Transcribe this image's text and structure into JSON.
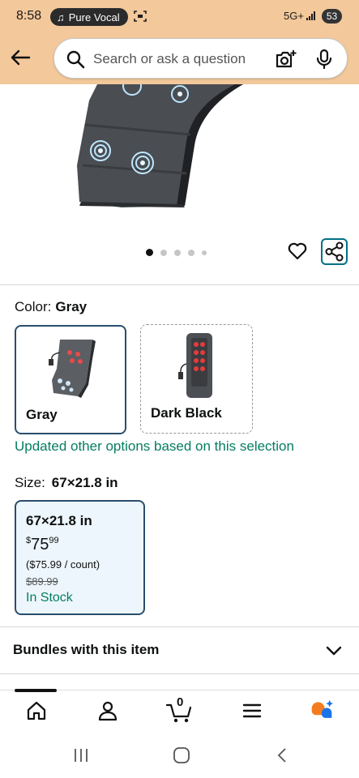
{
  "status_bar": {
    "time": "8:58",
    "pill_label": "Pure Vocal",
    "network": "5G+",
    "battery": "53"
  },
  "search": {
    "placeholder": "Search or ask a question"
  },
  "icons": {
    "back": "back-arrow-icon",
    "search": "search-icon",
    "camera": "camera-search-icon",
    "mic": "microphone-icon",
    "heart": "heart-icon",
    "share": "share-icon"
  },
  "carousel": {
    "count": 5,
    "active_index": 0
  },
  "color": {
    "label": "Color:",
    "selected": "Gray",
    "options": [
      {
        "name": "Gray",
        "selected": true
      },
      {
        "name": "Dark Black",
        "selected": false
      }
    ],
    "note": "Updated other options based on this selection"
  },
  "size": {
    "label": "Size:",
    "selected": "67×21.8 in",
    "option": {
      "name": "67×21.8 in",
      "price_symbol": "$",
      "price_whole": "75",
      "price_fraction": "99",
      "unit_price": "($75.99 / count)",
      "list_price": "$89.99",
      "availability": "In Stock"
    }
  },
  "bundles": {
    "title": "Bundles with this item"
  },
  "bottom_nav": [
    {
      "name": "home-icon"
    },
    {
      "name": "account-icon"
    },
    {
      "name": "cart-icon",
      "count": "0"
    },
    {
      "name": "menu-icon"
    },
    {
      "name": "rufus-icon"
    }
  ],
  "colors": {
    "header_bg": "#f3c89a",
    "accent_teal": "#007185",
    "selected_border": "#2a4e6c",
    "green": "#067d62"
  }
}
